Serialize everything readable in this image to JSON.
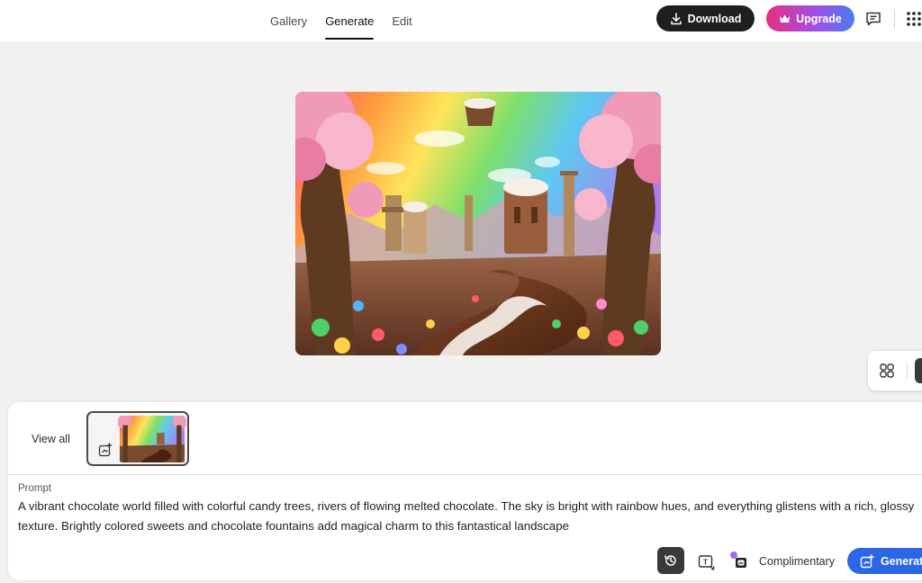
{
  "nav": {
    "tabs": [
      {
        "label": "Gallery",
        "active": false
      },
      {
        "label": "Generate",
        "active": true
      },
      {
        "label": "Edit",
        "active": false
      }
    ]
  },
  "header": {
    "download_label": "Download",
    "download_icon": "download-icon",
    "upgrade_label": "Upgrade",
    "upgrade_icon": "crown-icon",
    "feedback_icon": "feedback-icon",
    "apps_icon": "app-grid-icon"
  },
  "layout_toolbar": {
    "grid_icon": "grid-view-icon",
    "single_icon": "single-view-icon"
  },
  "history": {
    "view_all_label": "View all",
    "thumbnail_icon": "variation-icon"
  },
  "prompt": {
    "label": "Prompt",
    "text": "A vibrant chocolate world filled with colorful candy trees, rivers of flowing melted chocolate. The sky is bright with rainbow hues, and everything glistens with a rich, glossy texture. Brightly colored sweets and chocolate fountains add magical charm to this fantastical landscape"
  },
  "actions": {
    "history_icon": "history-icon",
    "prompt_tool_icon": "text-to-image-icon",
    "style_icon": "style-reference-icon",
    "credits_label": "Complimentary",
    "generate_label": "Generate",
    "generate_icon": "generate-icon"
  },
  "colors": {
    "download_bg": "#1f1f1f",
    "upgrade_gradient": [
      "#e4307f",
      "#a34ee3",
      "#4a7df2"
    ],
    "generate_bg": "#2a66e6",
    "canvas_bg": "#f1f1f1"
  }
}
